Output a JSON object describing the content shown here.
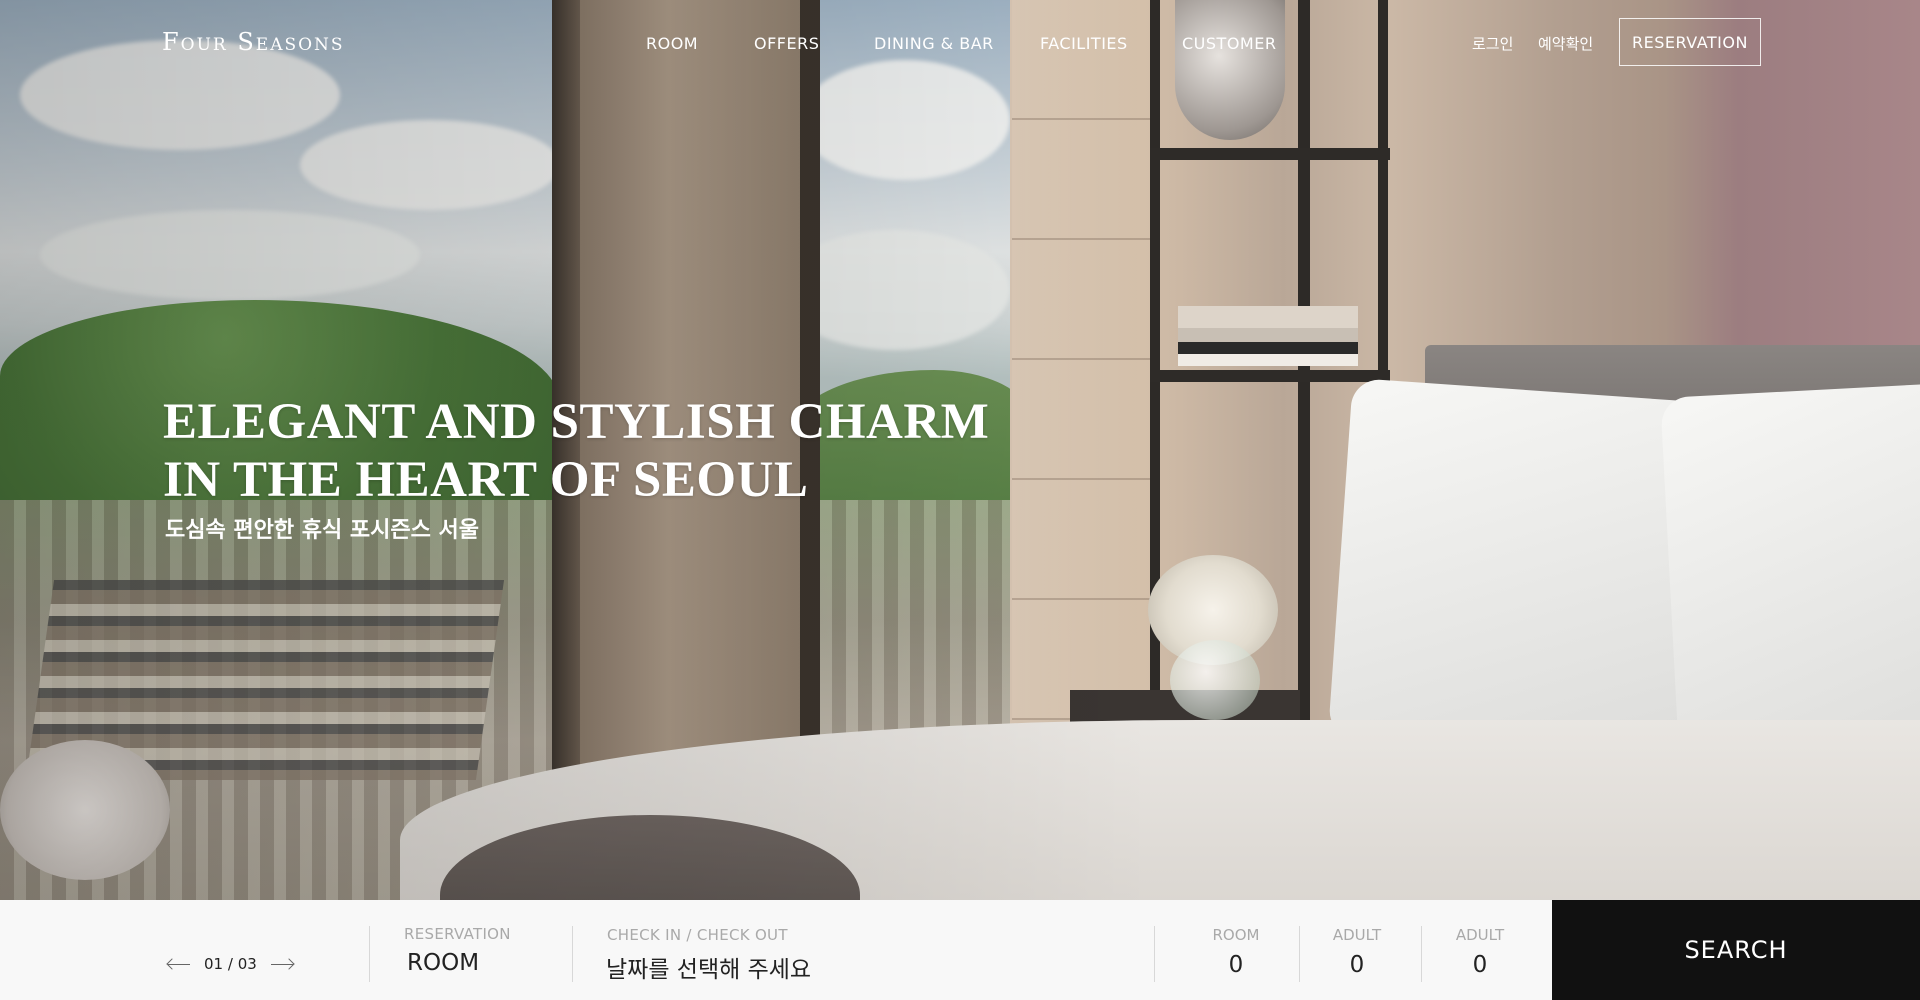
{
  "brand": {
    "logo": "Four Seasons"
  },
  "nav": {
    "items": [
      "ROOM",
      "OFFERS",
      "DINING & BAR",
      "FACILITIES",
      "CUSTOMER"
    ]
  },
  "utility": {
    "login": "로그인",
    "booking_check": "예약확인",
    "reservation_button": "RESERVATION"
  },
  "hero": {
    "headline_line1": "ELEGANT AND STYLISH CHARM",
    "headline_line2": "IN THE HEART OF SEOUL",
    "subtitle": "도심속 편안한 휴식 포시즌스 서울"
  },
  "slider": {
    "current": "01",
    "total": "03",
    "separator": "/"
  },
  "booking": {
    "reservation_label": "RESERVATION",
    "reservation_value": "ROOM",
    "dates_label": "CHECK IN / CHECK OUT",
    "dates_value": "날짜를 선택해 주세요",
    "counts": [
      {
        "label": "ROOM",
        "value": "0"
      },
      {
        "label": "ADULT",
        "value": "0"
      },
      {
        "label": "ADULT",
        "value": "0"
      }
    ],
    "search_label": "SEARCH"
  },
  "colors": {
    "bar_bg": "#f8f8f8",
    "search_bg": "#111111",
    "label_gray": "#a9a9a9"
  }
}
